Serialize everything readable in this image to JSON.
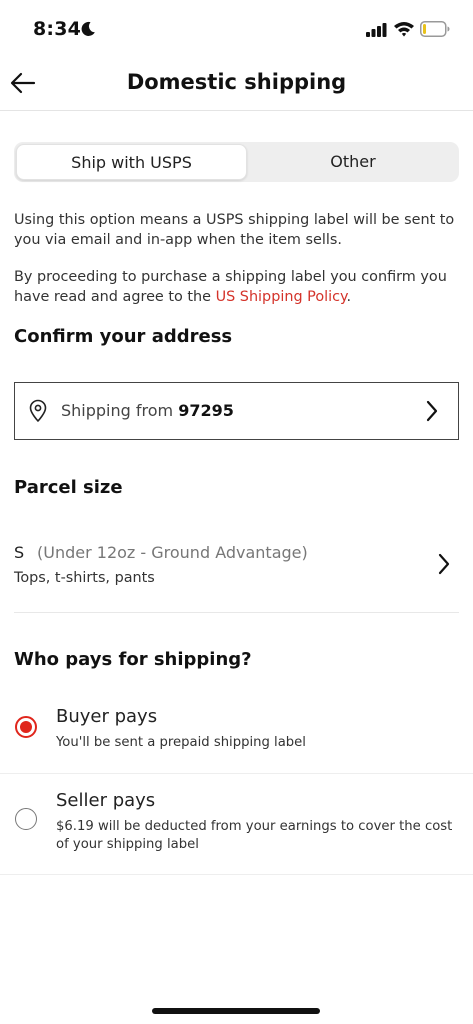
{
  "status_bar": {
    "time": "8:34",
    "icons": [
      "moon-icon",
      "signal-icon",
      "wifi-icon",
      "battery-icon"
    ]
  },
  "header": {
    "back_icon": "arrow-left-icon",
    "title": "Domestic shipping"
  },
  "tabs": {
    "items": [
      {
        "label": "Ship with USPS",
        "selected": true
      },
      {
        "label": "Other",
        "selected": false
      }
    ]
  },
  "info": {
    "paragraph1": "Using this option means a USPS shipping label will be sent to you via email and in-app when the item sells.",
    "paragraph2_prefix": "By proceeding to purchase a shipping label you confirm you have read and agree to the ",
    "policy_link": "US Shipping Policy",
    "paragraph2_suffix": "."
  },
  "address": {
    "heading": "Confirm your address",
    "prefix": "Shipping from ",
    "zip": "97295",
    "icon": "map-pin-icon"
  },
  "parcel": {
    "heading": "Parcel size",
    "size": "S",
    "description": "(Under 12oz - Ground Advantage)",
    "examples": "Tops, t-shirts, pants"
  },
  "payer": {
    "heading": "Who pays for shipping?",
    "options": [
      {
        "title": "Buyer pays",
        "subtitle": "You'll be sent a prepaid shipping label",
        "selected": true
      },
      {
        "title": "Seller pays",
        "subtitle": "$6.19 will be deducted from your earnings to cover the cost of your shipping label",
        "selected": false
      }
    ]
  },
  "colors": {
    "accent": "#e0261c",
    "link": "#d4332a",
    "segment_bg": "#eeeeee"
  }
}
